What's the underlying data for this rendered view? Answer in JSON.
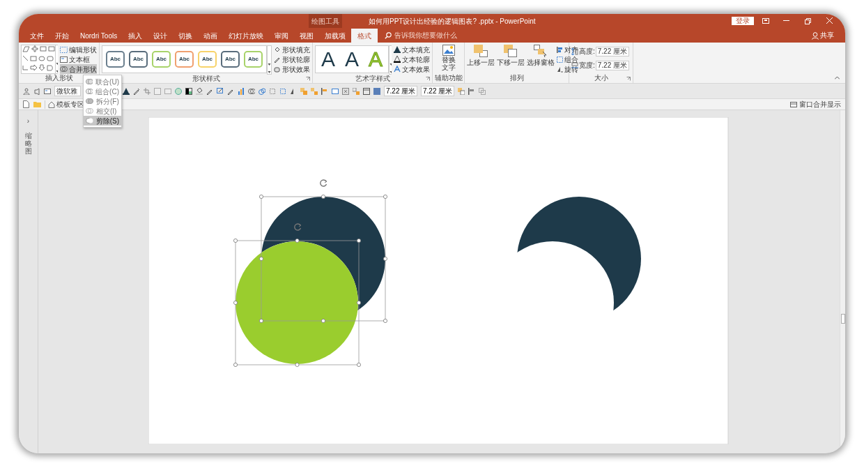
{
  "title_bar": {
    "context_tab": "绘图工具",
    "title": "如何用PPT设计出经验的逻辑图表? .pptx - PowerPoint",
    "login": "登录"
  },
  "tabs": [
    {
      "label": "文件",
      "selected": false
    },
    {
      "label": "开始",
      "selected": false
    },
    {
      "label": "Nordri Tools",
      "selected": false
    },
    {
      "label": "插入",
      "selected": false
    },
    {
      "label": "设计",
      "selected": false
    },
    {
      "label": "切换",
      "selected": false
    },
    {
      "label": "动画",
      "selected": false
    },
    {
      "label": "幻灯片放映",
      "selected": false
    },
    {
      "label": "审阅",
      "selected": false
    },
    {
      "label": "视图",
      "selected": false
    },
    {
      "label": "加载项",
      "selected": false
    },
    {
      "label": "格式",
      "selected": true
    }
  ],
  "search": {
    "placeholder": "告诉我你想要做什么"
  },
  "share": "共享",
  "ribbon": {
    "insert_shapes": {
      "label": "插入形状",
      "buttons": [
        "编辑形状",
        "文本框",
        "合并形状"
      ]
    },
    "shape_styles": {
      "label": "形状样式",
      "presets": [
        {
          "label": "Abc",
          "color": "#6b7f8e"
        },
        {
          "label": "Abc",
          "color": "#5a6d7c"
        },
        {
          "label": "Abc",
          "color": "#a8d36a"
        },
        {
          "label": "Abc",
          "color": "#f0a070"
        },
        {
          "label": "Abc",
          "color": "#f7d36b"
        },
        {
          "label": "Abc",
          "color": "#5a6d7c"
        },
        {
          "label": "Abc",
          "color": "#a8d36a"
        }
      ],
      "commands": [
        "形状填充",
        "形状轮廓",
        "形状效果"
      ]
    },
    "wordart": {
      "label": "艺术字样式",
      "letters": [
        {
          "label": "A",
          "color": "#1e3a4a",
          "kind": "filled"
        },
        {
          "label": "A",
          "color": "#1e3a4a",
          "kind": "filled"
        },
        {
          "label": "A",
          "color": "#9acd32",
          "kind": "outline"
        }
      ],
      "commands": [
        "文本填充",
        "文本轮廓",
        "文本效果"
      ]
    },
    "accessibility": {
      "label": "辅助功能",
      "button": "替换文字"
    },
    "arrange": {
      "label": "排列",
      "buttons": [
        "上移一层",
        "下移一层",
        "选择窗格"
      ],
      "small": [
        "对齐",
        "组合",
        "旋转"
      ]
    },
    "size": {
      "label": "大小",
      "fields": [
        {
          "label": "高度:",
          "value": "7.22 厘米"
        },
        {
          "label": "宽度:",
          "value": "7.22 厘米"
        }
      ]
    }
  },
  "merge_menu": [
    {
      "label": "联合(U)",
      "selected": false
    },
    {
      "label": "组合(C)",
      "selected": false
    },
    {
      "label": "拆分(F)",
      "selected": false
    },
    {
      "label": "相交(I)",
      "selected": false
    },
    {
      "label": "剪除(S)",
      "selected": true
    }
  ],
  "toolbar": {
    "font": "微软雅",
    "fields": [
      "7.22 厘米",
      "7.22 厘米"
    ]
  },
  "toolbar2": {
    "template": "模板专区",
    "merge_window": "窗口合并显示"
  },
  "thumbnail_pane": {
    "expand": "›",
    "label": "缩略图"
  }
}
